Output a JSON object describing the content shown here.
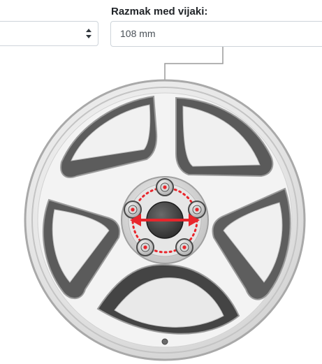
{
  "form": {
    "bolt_spacing_label": "Razmak med vijaki:",
    "bolt_spacing_value": "108 mm"
  },
  "wheel": {
    "bolt_count": 5,
    "highlight_color": "#e8262c"
  },
  "icons": {
    "select_arrow": "sort-arrows-icon"
  }
}
